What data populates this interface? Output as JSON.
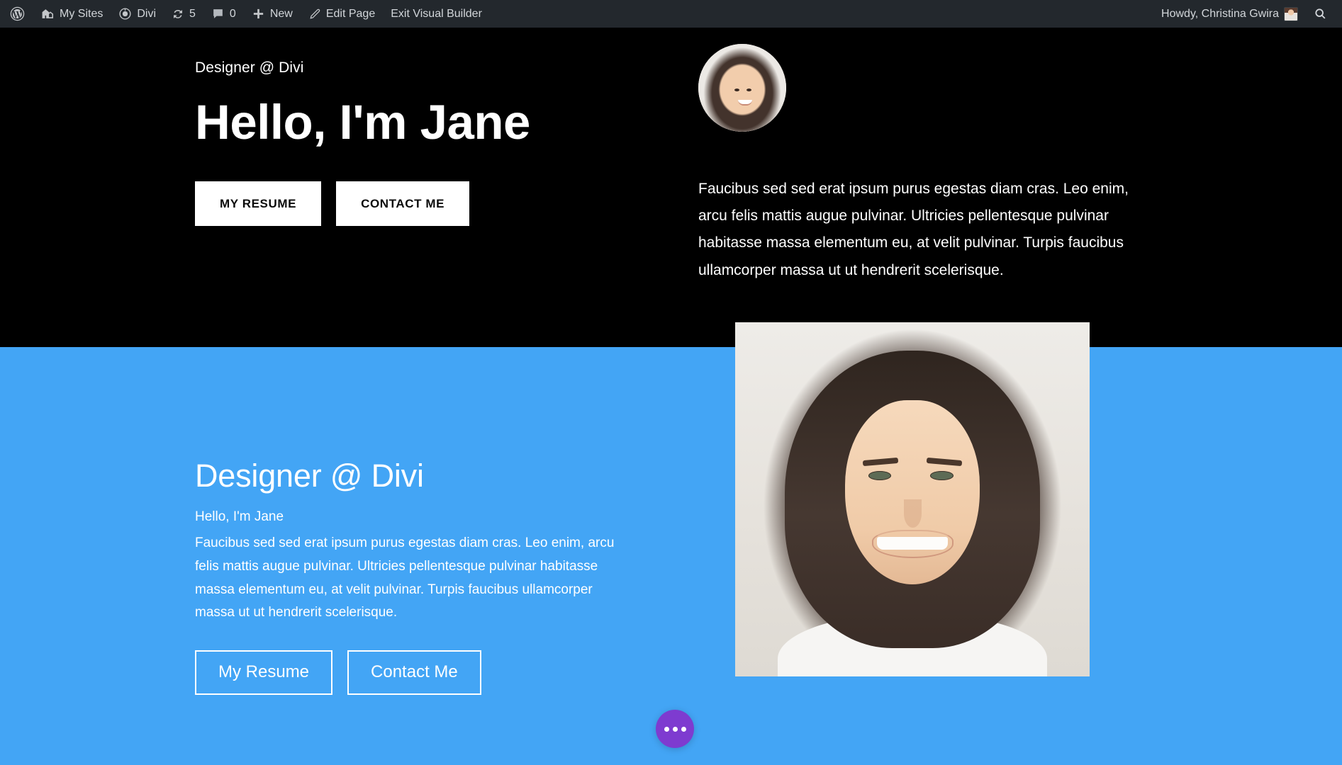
{
  "admin_bar": {
    "background": "#23282d",
    "left_items": [
      {
        "name": "wordpress-logo",
        "icon": "wordpress-icon",
        "label": ""
      },
      {
        "name": "my-sites",
        "icon": "sites-icon",
        "label": "My Sites"
      },
      {
        "name": "divi",
        "icon": "divi-icon",
        "label": "Divi"
      },
      {
        "name": "updates",
        "icon": "updates-icon",
        "label": "5"
      },
      {
        "name": "comments",
        "icon": "comment-bubble-icon",
        "label": "0"
      },
      {
        "name": "new",
        "icon": "plus-icon",
        "label": "New"
      },
      {
        "name": "edit-page",
        "icon": "pencil-icon",
        "label": "Edit Page"
      },
      {
        "name": "exit-visual-builder",
        "icon": "",
        "label": "Exit Visual Builder"
      }
    ],
    "greeting": "Howdy, Christina Gwira",
    "search_icon": "search-icon"
  },
  "hero": {
    "background": "#000000",
    "eyebrow": "Designer @ Divi",
    "title": "Hello, I'm Jane",
    "buttons": [
      {
        "name": "my-resume-button",
        "label": "MY RESUME"
      },
      {
        "name": "contact-me-button",
        "label": "CONTACT ME"
      }
    ],
    "avatar_alt": "portrait-avatar",
    "paragraph": "Faucibus sed sed erat ipsum purus egestas diam cras. Leo enim, arcu felis mattis augue pulvinar. Ultricies pellentesque pulvinar habitasse massa elementum eu, at velit pulvinar. Turpis faucibus ullamcorper massa ut ut hendrerit scelerisque."
  },
  "blue_section": {
    "background": "#43a5f5",
    "title": "Designer @ Divi",
    "subtitle": "Hello, I'm Jane",
    "paragraph": "Faucibus sed sed erat ipsum purus egestas diam cras. Leo enim, arcu felis mattis augue pulvinar. Ultricies pellentesque pulvinar habitasse massa elementum eu, at velit pulvinar. Turpis faucibus ullamcorper massa ut ut hendrerit scelerisque.",
    "buttons": [
      {
        "name": "my-resume-button",
        "label": "My Resume"
      },
      {
        "name": "contact-me-button",
        "label": "Contact Me"
      }
    ],
    "photo_alt": "portrait-photo"
  },
  "divi_fab": {
    "name": "divi-builder-toggle",
    "color": "#7e3bd0",
    "icon": "ellipsis-icon"
  }
}
